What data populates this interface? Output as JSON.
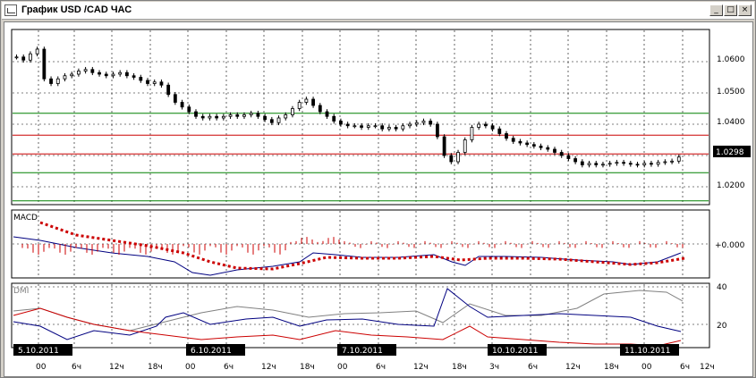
{
  "window": {
    "title": "График USD /CAD  ЧАС",
    "minimize_glyph": "_",
    "maximize_glyph": "□",
    "close_glyph": "×"
  },
  "price_panel": {
    "y_ticks": [
      "1.0600",
      "1.0500",
      "1.0400",
      "1.0298",
      "1.0200"
    ],
    "current_price": "1.0298",
    "horizontal_levels": [
      {
        "value": 1.0435,
        "color": "#008000"
      },
      {
        "value": 1.0365,
        "color": "#cc0000"
      },
      {
        "value": 1.0305,
        "color": "#cc0000"
      },
      {
        "value": 1.0245,
        "color": "#008000"
      },
      {
        "value": 1.0155,
        "color": "#008000"
      }
    ]
  },
  "macd_panel": {
    "label": "MACD",
    "zero_label": "+0.000"
  },
  "dmi_panel": {
    "label": "DMI",
    "y_ticks": [
      "40",
      "20"
    ]
  },
  "date_labels": [
    "5.10.2011",
    "6.10.2011",
    "7.10.2011",
    "10.10.2011",
    "11.10.2011"
  ],
  "time_ticks": [
    "00",
    "6",
    "12",
    "18",
    "00",
    "6",
    "12",
    "18",
    "00",
    "6",
    "12",
    "18",
    "3",
    "6",
    "12",
    "18",
    "00",
    "6",
    "12"
  ],
  "time_tick_suffix": "ч",
  "colors": {
    "grid": "#000000",
    "candle": "#000000",
    "macd_line": "#000080",
    "macd_signal": "#cc0000",
    "dmi_plus": "#000080",
    "dmi_minus": "#cc0000",
    "adx": "#808080"
  }
}
